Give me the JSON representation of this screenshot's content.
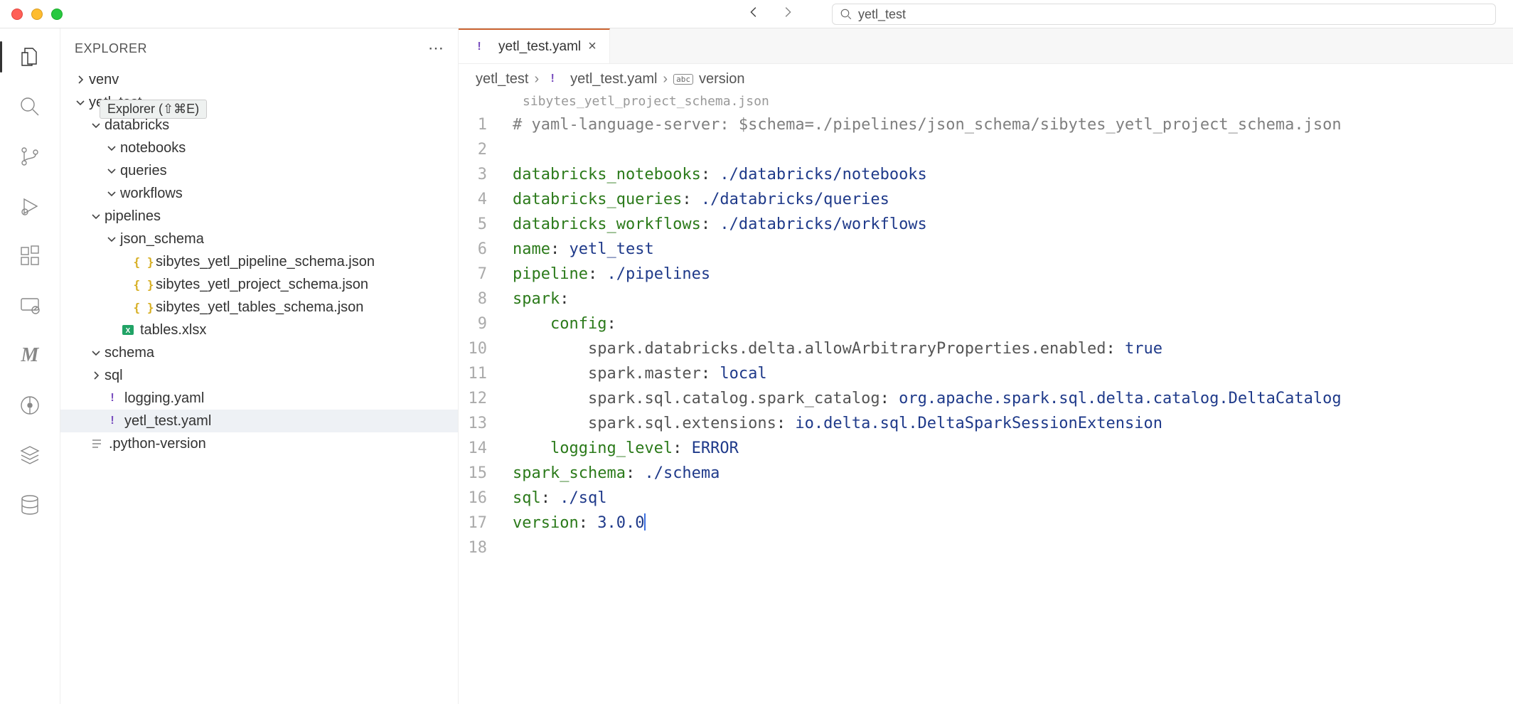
{
  "titlebar": {
    "search_value": "yetl_test"
  },
  "activity": {
    "items": [
      "files",
      "search",
      "source-control",
      "run-debug",
      "extensions",
      "remote",
      "m-custom",
      "git-graph",
      "stack",
      "database"
    ]
  },
  "sidebar": {
    "title": "EXPLORER",
    "tooltip": "Explorer (⇧⌘E)"
  },
  "tree": [
    {
      "depth": 0,
      "kind": "folder",
      "open": false,
      "name": "venv",
      "partially_hidden": true
    },
    {
      "depth": 0,
      "kind": "folder",
      "open": true,
      "name": "yetl_test"
    },
    {
      "depth": 1,
      "kind": "folder",
      "open": true,
      "name": "databricks"
    },
    {
      "depth": 2,
      "kind": "folder",
      "open": true,
      "name": "notebooks"
    },
    {
      "depth": 2,
      "kind": "folder",
      "open": true,
      "name": "queries"
    },
    {
      "depth": 2,
      "kind": "folder",
      "open": true,
      "name": "workflows"
    },
    {
      "depth": 1,
      "kind": "folder",
      "open": true,
      "name": "pipelines"
    },
    {
      "depth": 2,
      "kind": "folder",
      "open": true,
      "name": "json_schema"
    },
    {
      "depth": 3,
      "kind": "file",
      "icon": "json",
      "name": "sibytes_yetl_pipeline_schema.json"
    },
    {
      "depth": 3,
      "kind": "file",
      "icon": "json",
      "name": "sibytes_yetl_project_schema.json"
    },
    {
      "depth": 3,
      "kind": "file",
      "icon": "json",
      "name": "sibytes_yetl_tables_schema.json"
    },
    {
      "depth": 2,
      "kind": "file",
      "icon": "xlsx",
      "name": "tables.xlsx"
    },
    {
      "depth": 1,
      "kind": "folder",
      "open": true,
      "name": "schema"
    },
    {
      "depth": 1,
      "kind": "folder",
      "open": false,
      "name": "sql"
    },
    {
      "depth": 1,
      "kind": "file",
      "icon": "yaml",
      "name": "logging.yaml"
    },
    {
      "depth": 1,
      "kind": "file",
      "icon": "yaml",
      "name": "yetl_test.yaml",
      "selected": true
    },
    {
      "depth": 0,
      "kind": "file",
      "icon": "txt",
      "name": ".python-version"
    }
  ],
  "tab": {
    "icon": "yaml",
    "label": "yetl_test.yaml"
  },
  "breadcrumbs": {
    "parts": [
      "yetl_test",
      "yetl_test.yaml",
      "version"
    ]
  },
  "schema_hint": "sibytes_yetl_project_schema.json",
  "code": [
    {
      "n": 1,
      "segs": [
        [
          "comment",
          "# yaml-language-server: $schema=./pipelines/json_schema/sibytes_yetl_project_schema.json"
        ]
      ]
    },
    {
      "n": 2,
      "segs": []
    },
    {
      "n": 3,
      "segs": [
        [
          "key",
          "databricks_notebooks"
        ],
        [
          "pun",
          ":"
        ],
        [
          "sp",
          " "
        ],
        [
          "str",
          "./databricks/notebooks"
        ]
      ]
    },
    {
      "n": 4,
      "segs": [
        [
          "key",
          "databricks_queries"
        ],
        [
          "pun",
          ":"
        ],
        [
          "sp",
          " "
        ],
        [
          "str",
          "./databricks/queries"
        ]
      ]
    },
    {
      "n": 5,
      "segs": [
        [
          "key",
          "databricks_workflows"
        ],
        [
          "pun",
          ":"
        ],
        [
          "sp",
          " "
        ],
        [
          "str",
          "./databricks/workflows"
        ]
      ]
    },
    {
      "n": 6,
      "segs": [
        [
          "key",
          "name"
        ],
        [
          "pun",
          ":"
        ],
        [
          "sp",
          " "
        ],
        [
          "str",
          "yetl_test"
        ]
      ]
    },
    {
      "n": 7,
      "segs": [
        [
          "key",
          "pipeline"
        ],
        [
          "pun",
          ":"
        ],
        [
          "sp",
          " "
        ],
        [
          "str",
          "./pipelines"
        ]
      ]
    },
    {
      "n": 8,
      "segs": [
        [
          "key",
          "spark"
        ],
        [
          "pun",
          ":"
        ]
      ]
    },
    {
      "n": 9,
      "segs": [
        [
          "sp",
          "    "
        ],
        [
          "key",
          "config"
        ],
        [
          "pun",
          ":"
        ]
      ]
    },
    {
      "n": 10,
      "segs": [
        [
          "sp",
          "        "
        ],
        [
          "conf",
          "spark.databricks.delta.allowArbitraryProperties.enabled"
        ],
        [
          "pun",
          ":"
        ],
        [
          "sp",
          " "
        ],
        [
          "bool",
          "true"
        ]
      ]
    },
    {
      "n": 11,
      "segs": [
        [
          "sp",
          "        "
        ],
        [
          "conf",
          "spark.master"
        ],
        [
          "pun",
          ":"
        ],
        [
          "sp",
          " "
        ],
        [
          "str",
          "local"
        ]
      ]
    },
    {
      "n": 12,
      "segs": [
        [
          "sp",
          "        "
        ],
        [
          "conf",
          "spark.sql.catalog.spark_catalog"
        ],
        [
          "pun",
          ":"
        ],
        [
          "sp",
          " "
        ],
        [
          "str",
          "org.apache.spark.sql.delta.catalog.DeltaCatalog"
        ]
      ]
    },
    {
      "n": 13,
      "segs": [
        [
          "sp",
          "        "
        ],
        [
          "conf",
          "spark.sql.extensions"
        ],
        [
          "pun",
          ":"
        ],
        [
          "sp",
          " "
        ],
        [
          "str",
          "io.delta.sql.DeltaSparkSessionExtension"
        ]
      ]
    },
    {
      "n": 14,
      "segs": [
        [
          "sp",
          "    "
        ],
        [
          "key",
          "logging_level"
        ],
        [
          "pun",
          ":"
        ],
        [
          "sp",
          " "
        ],
        [
          "str",
          "ERROR"
        ]
      ]
    },
    {
      "n": 15,
      "segs": [
        [
          "key",
          "spark_schema"
        ],
        [
          "pun",
          ":"
        ],
        [
          "sp",
          " "
        ],
        [
          "str",
          "./schema"
        ]
      ]
    },
    {
      "n": 16,
      "segs": [
        [
          "key",
          "sql"
        ],
        [
          "pun",
          ":"
        ],
        [
          "sp",
          " "
        ],
        [
          "str",
          "./sql"
        ]
      ]
    },
    {
      "n": 17,
      "segs": [
        [
          "key",
          "version"
        ],
        [
          "pun",
          ":"
        ],
        [
          "sp",
          " "
        ],
        [
          "str",
          "3.0.0"
        ]
      ],
      "cursor": true
    },
    {
      "n": 18,
      "segs": []
    }
  ]
}
